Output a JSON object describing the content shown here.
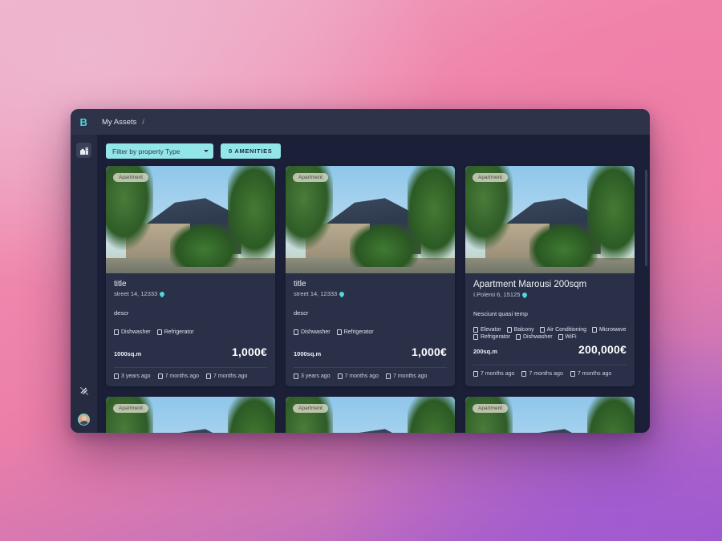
{
  "app": {
    "logo": "B",
    "breadcrumb": {
      "root": "My Assets",
      "separator": "/"
    }
  },
  "sidebar": {
    "items": [
      {
        "name": "properties",
        "icon": "building-icon"
      },
      {
        "name": "logout",
        "icon": "logout-slash-icon"
      },
      {
        "name": "profile",
        "icon": "avatar-icon"
      }
    ]
  },
  "filters": {
    "property_type": {
      "label": "Filter by property Type",
      "caret": "chevron-down-icon"
    },
    "amenities_button": "0 AMENITIES"
  },
  "colors": {
    "accent": "#4fd8dd",
    "filter_bg": "#93e6e8",
    "window_bg": "#1b2038",
    "card_bg": "#2a3048",
    "topbar_bg": "#2e3349",
    "sidebar_bg": "#262b42"
  },
  "cards": [
    {
      "badge": "Apartment",
      "title": "title",
      "address": "street 14, 12333",
      "description": "descr",
      "amenities": [
        "Dishwasher",
        "Refrigerator"
      ],
      "size": "1000sq.m",
      "price": "1,000€",
      "dates": [
        "3 years ago",
        "7 months ago",
        "7 months ago"
      ]
    },
    {
      "badge": "Apartment",
      "title": "title",
      "address": "street 14, 12333",
      "description": "descr",
      "amenities": [
        "Dishwasher",
        "Refrigerator"
      ],
      "size": "1000sq.m",
      "price": "1,000€",
      "dates": [
        "3 years ago",
        "7 months ago",
        "7 months ago"
      ]
    },
    {
      "badge": "Apartment",
      "title": "Apartment Marousi 200sqm",
      "address": "I.Polemi 6, 15125",
      "description": "Nesciunt quasi temp",
      "amenities": [
        "Elevator",
        "Balcony",
        "Air Conditioning",
        "Microwave",
        "Refrigerator",
        "Dishwasher",
        "WiFi"
      ],
      "size": "200sq.m",
      "price": "200,000€",
      "dates": [
        "7 months ago",
        "7 months ago",
        "7 months ago"
      ]
    }
  ],
  "row2": [
    {
      "badge": "Apartment"
    },
    {
      "badge": "Apartment"
    },
    {
      "badge": "Apartment"
    }
  ]
}
